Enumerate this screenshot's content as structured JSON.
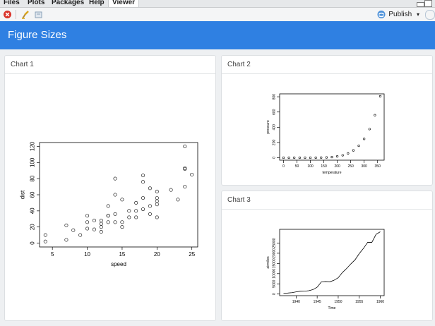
{
  "tabs": [
    {
      "label": "Files",
      "active": false
    },
    {
      "label": "Plots",
      "active": false
    },
    {
      "label": "Packages",
      "active": false
    },
    {
      "label": "Help",
      "active": false
    },
    {
      "label": "Viewer",
      "active": true
    }
  ],
  "toolbar": {
    "publish_label": "Publish"
  },
  "header": {
    "title": "Figure Sizes",
    "color": "#2f80e2"
  },
  "cards": [
    {
      "title": "Chart 1"
    },
    {
      "title": "Chart 2"
    },
    {
      "title": "Chart 3"
    }
  ],
  "chart_data": [
    {
      "type": "scatter",
      "xlabel": "speed",
      "ylabel": "dist",
      "xlim": [
        4,
        25
      ],
      "ylim": [
        0,
        120
      ],
      "xticks": [
        5,
        10,
        15,
        20,
        25
      ],
      "yticks": [
        0,
        20,
        40,
        60,
        80,
        100,
        120
      ],
      "x": [
        4,
        4,
        7,
        7,
        8,
        9,
        10,
        10,
        10,
        11,
        11,
        12,
        12,
        12,
        12,
        13,
        13,
        13,
        13,
        14,
        14,
        14,
        14,
        15,
        15,
        15,
        16,
        16,
        17,
        17,
        17,
        18,
        18,
        18,
        18,
        19,
        19,
        19,
        20,
        20,
        20,
        20,
        20,
        22,
        23,
        24,
        24,
        24,
        24,
        25
      ],
      "y": [
        2,
        10,
        4,
        22,
        16,
        10,
        18,
        26,
        34,
        17,
        28,
        14,
        20,
        24,
        28,
        26,
        34,
        34,
        46,
        26,
        36,
        60,
        80,
        20,
        26,
        54,
        32,
        40,
        32,
        40,
        50,
        42,
        56,
        76,
        84,
        36,
        46,
        68,
        32,
        48,
        52,
        56,
        64,
        66,
        54,
        70,
        92,
        93,
        120,
        85
      ]
    },
    {
      "type": "scatter",
      "xlabel": "temperature",
      "ylabel": "pressure",
      "xlim": [
        0,
        360
      ],
      "ylim": [
        0,
        806
      ],
      "xticks": [
        0,
        50,
        100,
        150,
        200,
        250,
        300,
        350
      ],
      "yticks": [
        0,
        200,
        400,
        600,
        800
      ],
      "x": [
        0,
        20,
        40,
        60,
        80,
        100,
        120,
        140,
        160,
        180,
        200,
        220,
        240,
        260,
        280,
        300,
        320,
        340,
        360
      ],
      "y": [
        0.0002,
        0.0012,
        0.006,
        0.03,
        0.09,
        0.27,
        0.75,
        1.85,
        4.2,
        8.8,
        17.3,
        32.1,
        57,
        96,
        157,
        247,
        376,
        558,
        806
      ]
    },
    {
      "type": "line",
      "xlabel": "Time",
      "ylabel": "airmiles",
      "xlim": [
        1937,
        1960
      ],
      "ylim": [
        412,
        30514
      ],
      "xticks": [
        1940,
        1945,
        1950,
        1955,
        1960
      ],
      "yticks": [
        0,
        5000,
        10000,
        15000,
        20000,
        25000
      ],
      "x": [
        1937,
        1938,
        1939,
        1940,
        1941,
        1942,
        1943,
        1944,
        1945,
        1946,
        1947,
        1948,
        1949,
        1950,
        1951,
        1952,
        1953,
        1954,
        1955,
        1956,
        1957,
        1958,
        1959,
        1960
      ],
      "y": [
        412,
        480,
        683,
        1052,
        1385,
        1418,
        1634,
        2178,
        3362,
        5948,
        6109,
        5981,
        6753,
        8003,
        10566,
        12528,
        14760,
        16769,
        19819,
        22362,
        25340,
        25343,
        29269,
        30514
      ]
    }
  ]
}
